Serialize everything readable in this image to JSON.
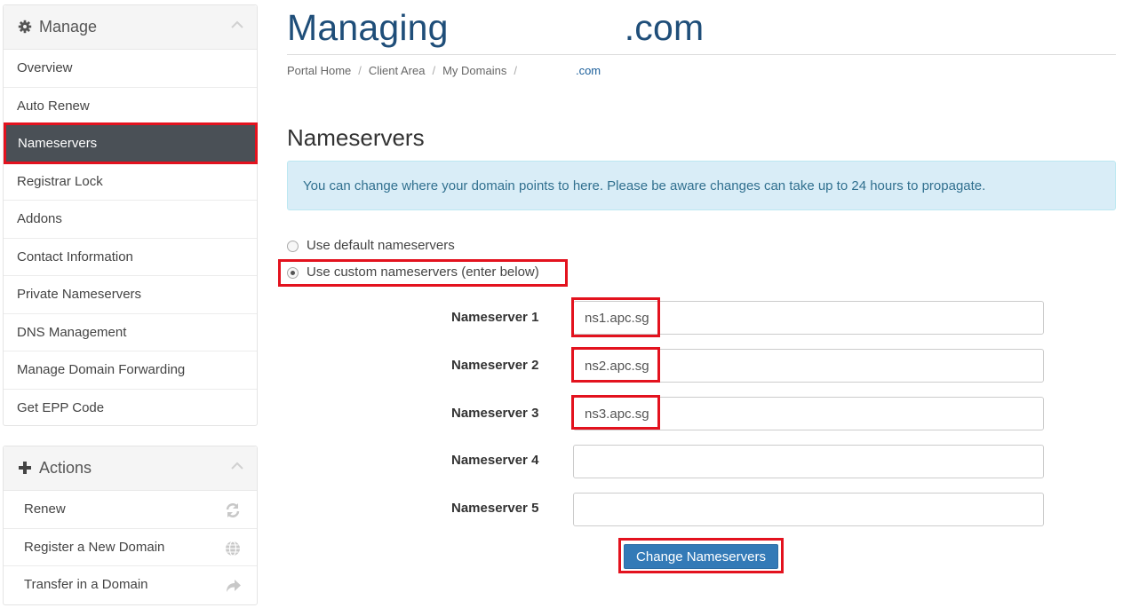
{
  "header": {
    "title_prefix": "Managing",
    "title_domain": ".com"
  },
  "breadcrumb": {
    "items": [
      "Portal Home",
      "Client Area",
      "My Domains"
    ],
    "current": ".com",
    "separator": "/"
  },
  "sidebar": {
    "manage": {
      "title": "Manage",
      "icon": "gear-icon",
      "items": [
        {
          "label": "Overview"
        },
        {
          "label": "Auto Renew"
        },
        {
          "label": "Nameservers",
          "active": true
        },
        {
          "label": "Registrar Lock"
        },
        {
          "label": "Addons"
        },
        {
          "label": "Contact Information"
        },
        {
          "label": "Private Nameservers"
        },
        {
          "label": "DNS Management"
        },
        {
          "label": "Manage Domain Forwarding"
        },
        {
          "label": "Get EPP Code"
        }
      ]
    },
    "actions": {
      "title": "Actions",
      "icon": "plus-icon",
      "items": [
        {
          "label": "Renew",
          "icon": "refresh-icon"
        },
        {
          "label": "Register a New Domain",
          "icon": "globe-icon"
        },
        {
          "label": "Transfer in a Domain",
          "icon": "share-arrow-icon"
        }
      ]
    }
  },
  "main": {
    "section_title": "Nameservers",
    "info_text": "You can change where your domain points to here. Please be aware changes can take up to 24 hours to propagate.",
    "radio_default": "Use default nameservers",
    "radio_custom": "Use custom nameservers (enter below)",
    "selected_option": "custom",
    "nameservers": [
      {
        "label": "Nameserver 1",
        "value": "ns1.apc.sg"
      },
      {
        "label": "Nameserver 2",
        "value": "ns2.apc.sg"
      },
      {
        "label": "Nameserver 3",
        "value": "ns3.apc.sg"
      },
      {
        "label": "Nameserver 4",
        "value": ""
      },
      {
        "label": "Nameserver 5",
        "value": ""
      }
    ],
    "submit_label": "Change Nameservers"
  },
  "colors": {
    "title": "#1f4e79",
    "active_nav": "#4a5056",
    "info_bg": "#d9edf7",
    "info_text": "#31708f",
    "button": "#337ab7",
    "highlight": "#e3121e"
  }
}
